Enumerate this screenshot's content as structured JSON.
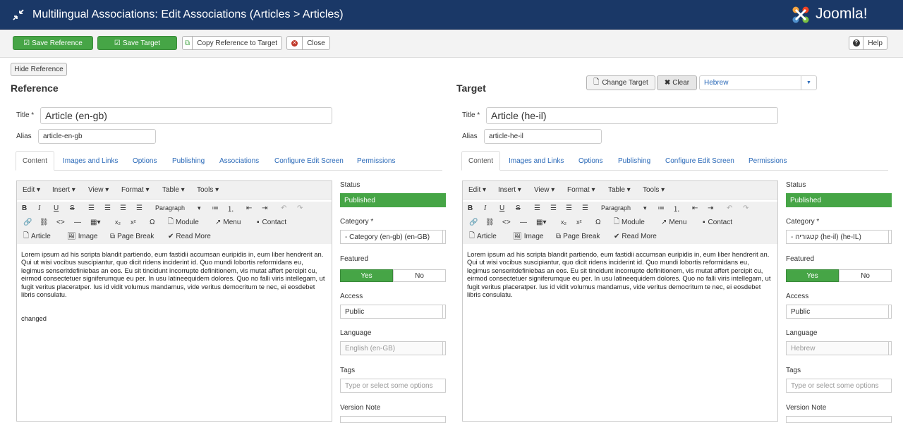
{
  "header": {
    "title": "Multilingual Associations: Edit Associations (Articles > Articles)",
    "logo_text": "Joomla!"
  },
  "toolbar": {
    "save_reference": "Save Reference",
    "save_target": "Save Target",
    "copy_reference": "Copy Reference to Target",
    "close": "Close",
    "help": "Help"
  },
  "hide_reference": "Hide Reference",
  "target_controls": {
    "change_target": "Change Target",
    "clear": "Clear",
    "language": "Hebrew"
  },
  "reference": {
    "heading": "Reference",
    "title_label": "Title *",
    "title_value": "Article (en-gb)",
    "alias_label": "Alias",
    "alias_value": "article-en-gb",
    "content_text": "Lorem ipsum ad his scripta blandit partiendo, eum fastidii accumsan euripidis in, eum liber hendrerit an. Qui ut wisi vocibus suscipiantur, quo dicit ridens inciderint id. Quo mundi lobortis reformidans eu, legimus senseritdefiniebas an eos. Eu sit tincidunt incorrupte definitionem, vis mutat affert percipit cu, eirmod consectetuer signiferumque eu per. In usu latineequidem dolores. Quo no falli viris intellegam, ut fugit veritus placeratper. Ius id vidit volumus mandamus, vide veritus democritum te nec, ei eosdebet libris consulatu.",
    "extra_text": "changed",
    "side": {
      "status": "Published",
      "category": "- Category (en-gb) (en-GB)",
      "access": "Public",
      "language": "English (en-GB)"
    }
  },
  "target": {
    "heading": "Target",
    "title_label": "Title *",
    "title_value": "Article (he-il)",
    "alias_label": "Alias",
    "alias_value": "article-he-il",
    "content_text": "Lorem ipsum ad his scripta blandit partiendo, eum fastidii accumsan euripidis in, eum liber hendrerit an. Qui ut wisi vocibus suscipiantur, quo dicit ridens inciderint id. Quo mundi lobortis reformidans eu, legimus senseritdefiniebas an eos. Eu sit tincidunt incorrupte definitionem, vis mutat affert percipit cu, eirmod consectetuer signiferumque eu per. In usu latineequidem dolores. Quo no falli viris intellegam, ut fugit veritus placeratper. Ius id vidit volumus mandamus, vide veritus democritum te nec, ei eosdebet libris consulatu.",
    "side": {
      "status": "Published",
      "category": "- קטגוריה (he-il) (he-IL)",
      "access": "Public",
      "language": "Hebrew"
    }
  },
  "tabs": [
    "Content",
    "Images and Links",
    "Options",
    "Publishing",
    "Associations",
    "Configure Edit Screen",
    "Permissions"
  ],
  "target_tabs": [
    "Content",
    "Images and Links",
    "Options",
    "Publishing",
    "Configure Edit Screen",
    "Permissions"
  ],
  "editor": {
    "menus": [
      "Edit",
      "Insert",
      "View",
      "Format",
      "Table",
      "Tools"
    ],
    "paragraph": "Paragraph",
    "module": "Module",
    "menu": "Menu",
    "contact": "Contact",
    "article": "Article",
    "image": "Image",
    "page_break": "Page Break",
    "read_more": "Read More"
  },
  "side_labels": {
    "status": "Status",
    "category": "Category *",
    "featured": "Featured",
    "yes": "Yes",
    "no": "No",
    "access": "Access",
    "language": "Language",
    "tags": "Tags",
    "tags_placeholder": "Type or select some options",
    "version_note": "Version Note"
  },
  "colors": {
    "header_bg": "#1a3867",
    "green": "#46a546",
    "link": "#2a69b8"
  }
}
